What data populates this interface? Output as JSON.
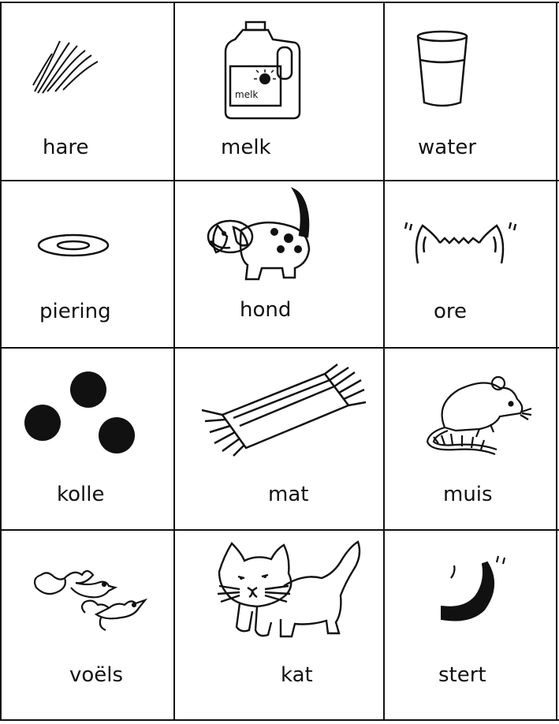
{
  "worksheet": {
    "cards": [
      {
        "word": "hare",
        "icon": "hair-icon"
      },
      {
        "word": "melk",
        "icon": "milk-jug-icon",
        "jug_label": "melk"
      },
      {
        "word": "water",
        "icon": "glass-of-water-icon"
      },
      {
        "word": "piering",
        "icon": "saucer-icon"
      },
      {
        "word": "hond",
        "icon": "dog-icon"
      },
      {
        "word": "ore",
        "icon": "cat-ears-icon"
      },
      {
        "word": "kolle",
        "icon": "three-dots-icon"
      },
      {
        "word": "mat",
        "icon": "rug-icon"
      },
      {
        "word": "muis",
        "icon": "mouse-icon"
      },
      {
        "word": "voëls",
        "icon": "birds-icon"
      },
      {
        "word": "kat",
        "icon": "cat-icon"
      },
      {
        "word": "stert",
        "icon": "tail-icon"
      }
    ]
  }
}
